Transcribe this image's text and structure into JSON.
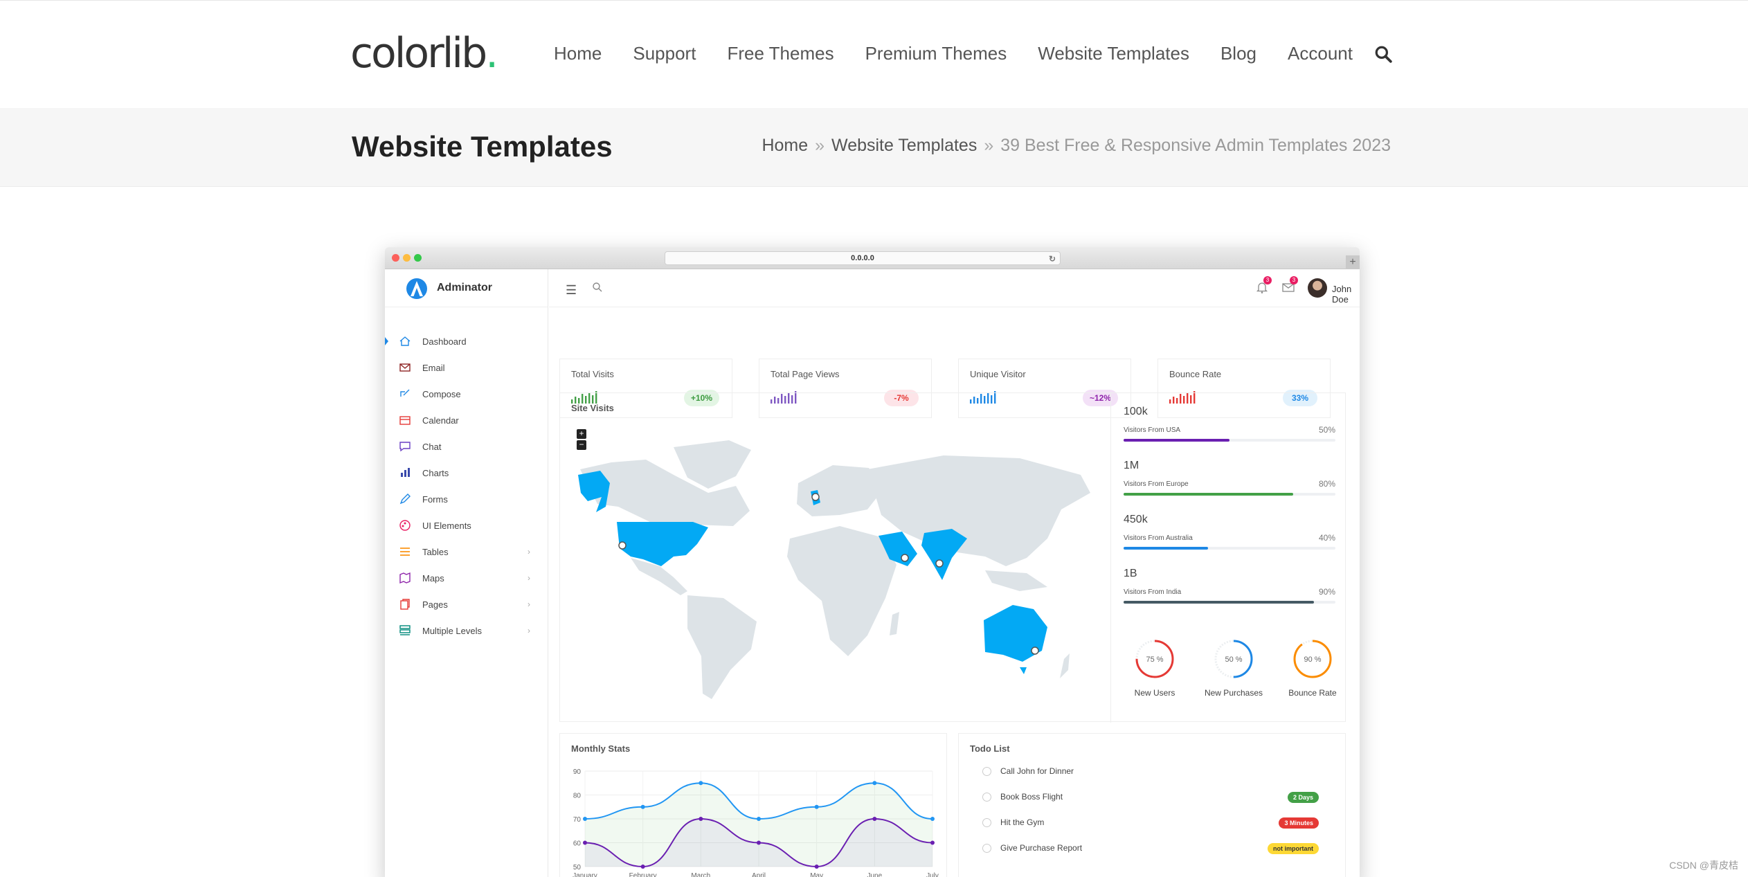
{
  "site": {
    "logo_text": "colorlib",
    "logo_dot": ".",
    "nav": [
      "Home",
      "Support",
      "Free Themes",
      "Premium Themes",
      "Website Templates",
      "Blog",
      "Account"
    ]
  },
  "title_band": {
    "title": "Website Templates",
    "breadcrumb": {
      "home": "Home",
      "sep": "»",
      "section": "Website Templates",
      "current": "39 Best Free & Responsive Admin Templates 2023"
    }
  },
  "browser": {
    "url": "0.0.0.0",
    "reload": "↻",
    "plus": "+"
  },
  "app": {
    "brand": "Adminator",
    "user": "John Doe",
    "notif_count": "3",
    "mail_count": "3",
    "menu": [
      {
        "label": "Dashboard",
        "icon": "home-icon",
        "color": "#1e88e5",
        "chevron": ""
      },
      {
        "label": "Email",
        "icon": "email-icon",
        "color": "#8e2424",
        "chevron": ""
      },
      {
        "label": "Compose",
        "icon": "compose-icon",
        "color": "#1e88e5",
        "chevron": ""
      },
      {
        "label": "Calendar",
        "icon": "calendar-icon",
        "color": "#e53935",
        "chevron": ""
      },
      {
        "label": "Chat",
        "icon": "chat-icon",
        "color": "#6a3fc4",
        "chevron": ""
      },
      {
        "label": "Charts",
        "icon": "charts-icon",
        "color": "#3949ab",
        "chevron": ""
      },
      {
        "label": "Forms",
        "icon": "forms-icon",
        "color": "#1e88e5",
        "chevron": ""
      },
      {
        "label": "UI Elements",
        "icon": "palette-icon",
        "color": "#e91e63",
        "chevron": ""
      },
      {
        "label": "Tables",
        "icon": "tables-icon",
        "color": "#fb8c00",
        "chevron": "›"
      },
      {
        "label": "Maps",
        "icon": "maps-icon",
        "color": "#8e24aa",
        "chevron": "›"
      },
      {
        "label": "Pages",
        "icon": "pages-icon",
        "color": "#e53935",
        "chevron": "›"
      },
      {
        "label": "Multiple Levels",
        "icon": "levels-icon",
        "color": "#00897b",
        "chevron": "›"
      }
    ],
    "stats": [
      {
        "title": "Total Visits",
        "badge": "+10%",
        "bar_color": "#43a047",
        "badge_bg": "#e3f5e4",
        "badge_fg": "#3d9a40"
      },
      {
        "title": "Total Page Views",
        "badge": "-7%",
        "bar_color": "#7e57c2",
        "badge_bg": "#fde4e8",
        "badge_fg": "#e53935"
      },
      {
        "title": "Unique Visitor",
        "badge": "~12%",
        "bar_color": "#1e88e5",
        "badge_bg": "#f3e1f7",
        "badge_fg": "#8e24aa"
      },
      {
        "title": "Bounce Rate",
        "badge": "33%",
        "bar_color": "#e53935",
        "badge_bg": "#e1f1fc",
        "badge_fg": "#1e88e5"
      }
    ],
    "site_visits": {
      "title": "Site Visits",
      "zoom_in": "+",
      "zoom_out": "−",
      "rows": [
        {
          "value": "100k",
          "label": "Visitors From USA",
          "pct": "50%",
          "fill": 0.5,
          "color": "#6a1fb1"
        },
        {
          "value": "1M",
          "label": "Visitors From Europe",
          "pct": "80%",
          "fill": 0.8,
          "color": "#43a047"
        },
        {
          "value": "450k",
          "label": "Visitors From Australia",
          "pct": "40%",
          "fill": 0.4,
          "color": "#1e88e5"
        },
        {
          "value": "1B",
          "label": "Visitors From India",
          "pct": "90%",
          "fill": 0.9,
          "color": "#455a64"
        }
      ],
      "gauges": [
        {
          "value": "75 %",
          "fraction": 0.75,
          "label": "New Users",
          "color": "#e53935"
        },
        {
          "value": "50 %",
          "fraction": 0.5,
          "label": "New Purchases",
          "color": "#1e88e5"
        },
        {
          "value": "90 %",
          "fraction": 0.9,
          "label": "Bounce Rate",
          "color": "#fb8c00"
        }
      ]
    },
    "monthly": {
      "title": "Monthly Stats",
      "chart_data": {
        "type": "line",
        "categories": [
          "January",
          "February",
          "March",
          "April",
          "May",
          "June",
          "July"
        ],
        "series": [
          {
            "values": [
              70,
              75,
              85,
              70,
              75,
              85,
              70
            ],
            "color": "#2196f3"
          },
          {
            "values": [
              60,
              50,
              70,
              60,
              50,
              70,
              60
            ],
            "color": "#6a1fb1"
          }
        ],
        "ylim": [
          50,
          90
        ],
        "yticks": [
          90,
          80,
          70,
          60,
          50
        ]
      }
    },
    "todo": {
      "title": "Todo List",
      "items": [
        {
          "text": "Call John for Dinner",
          "tag": "",
          "tag_bg": "",
          "tag_fg": ""
        },
        {
          "text": "Book Boss Flight",
          "tag": "2 Days",
          "tag_bg": "#43a047",
          "tag_fg": "#ffffff"
        },
        {
          "text": "Hit the Gym",
          "tag": "3 Minutes",
          "tag_bg": "#e53935",
          "tag_fg": "#ffffff"
        },
        {
          "text": "Give Purchase Report",
          "tag": "not important",
          "tag_bg": "#fdd835",
          "tag_fg": "#333333"
        }
      ]
    }
  },
  "watermark": "CSDN @青皮桔"
}
